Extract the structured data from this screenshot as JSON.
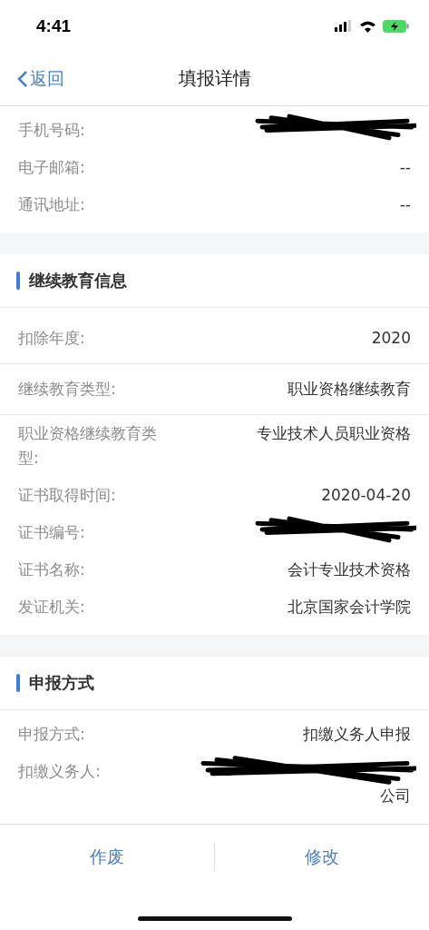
{
  "status_bar": {
    "time": "4:41"
  },
  "nav": {
    "back": "返回",
    "title": "填报详情"
  },
  "sections": [
    {
      "rows": [
        {
          "label": "手机号码:",
          "redacted": true,
          "separator": false
        },
        {
          "label": "电子邮箱:",
          "value": "--",
          "redacted": false,
          "separator": false
        },
        {
          "label": "通讯地址:",
          "value": "--",
          "redacted": false,
          "separator": false
        }
      ]
    },
    {
      "title": "继续教育信息",
      "rows": [
        {
          "label": "扣除年度:",
          "value": "2020",
          "redacted": false,
          "separator": true
        },
        {
          "label": "继续教育类型:",
          "value": "职业资格继续教育",
          "redacted": false,
          "separator": true
        },
        {
          "label": "职业资格继续教育类型:",
          "value": "专业技术人员职业资格",
          "redacted": false,
          "separator": false
        },
        {
          "label": "证书取得时间:",
          "value": "2020-04-20",
          "redacted": false,
          "separator": false
        },
        {
          "label": "证书编号:",
          "redacted": true,
          "separator": false
        },
        {
          "label": "证书名称:",
          "value": "会计专业技术资格",
          "redacted": false,
          "separator": false
        },
        {
          "label": "发证机关:",
          "value": "北京国家会计学院",
          "redacted": false,
          "separator": false
        }
      ]
    },
    {
      "title": "申报方式",
      "rows": [
        {
          "label": "申报方式:",
          "value": "扣缴义务人申报",
          "redacted": false,
          "separator": false
        },
        {
          "label": "扣缴义务人:",
          "value": "公司",
          "redacted": true,
          "separator": false
        }
      ]
    }
  ],
  "actions": [
    "作废",
    "修改"
  ]
}
